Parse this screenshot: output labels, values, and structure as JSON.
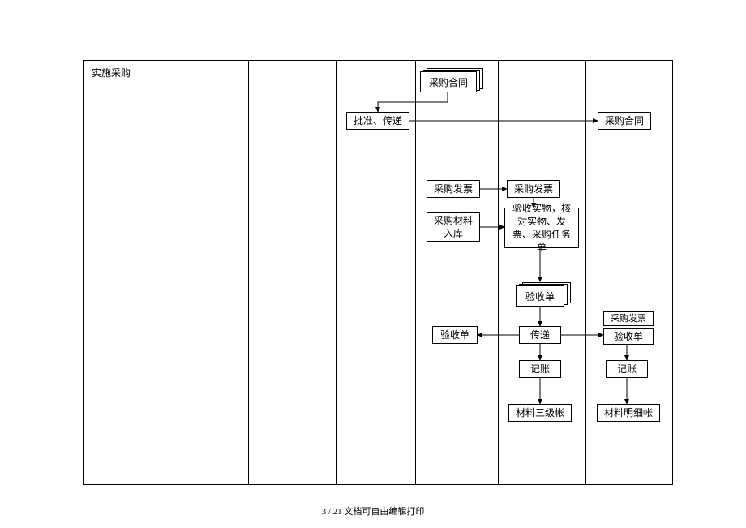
{
  "row_label": "实施采购",
  "footer": "3 / 21 文档可自由编辑打印",
  "nodes": {
    "contract_doc": "采购合同",
    "approve_relay": "批准、传递",
    "contract_right": "采购合同",
    "invoice_left": "采购发票",
    "invoice_right": "采购发票",
    "material_in": "采购材料\n入库",
    "verify": "验收实物，核对实物、发票、采购任务单",
    "receipt_doc": "验收单",
    "receipt_left": "验收单",
    "relay": "传递",
    "invoice_small": "采购发票",
    "receipt_right": "验收单",
    "bookkeep1": "记账",
    "bookkeep2": "记账",
    "ledger3": "材料三级帐",
    "ledger_detail": "材料明细帐"
  }
}
